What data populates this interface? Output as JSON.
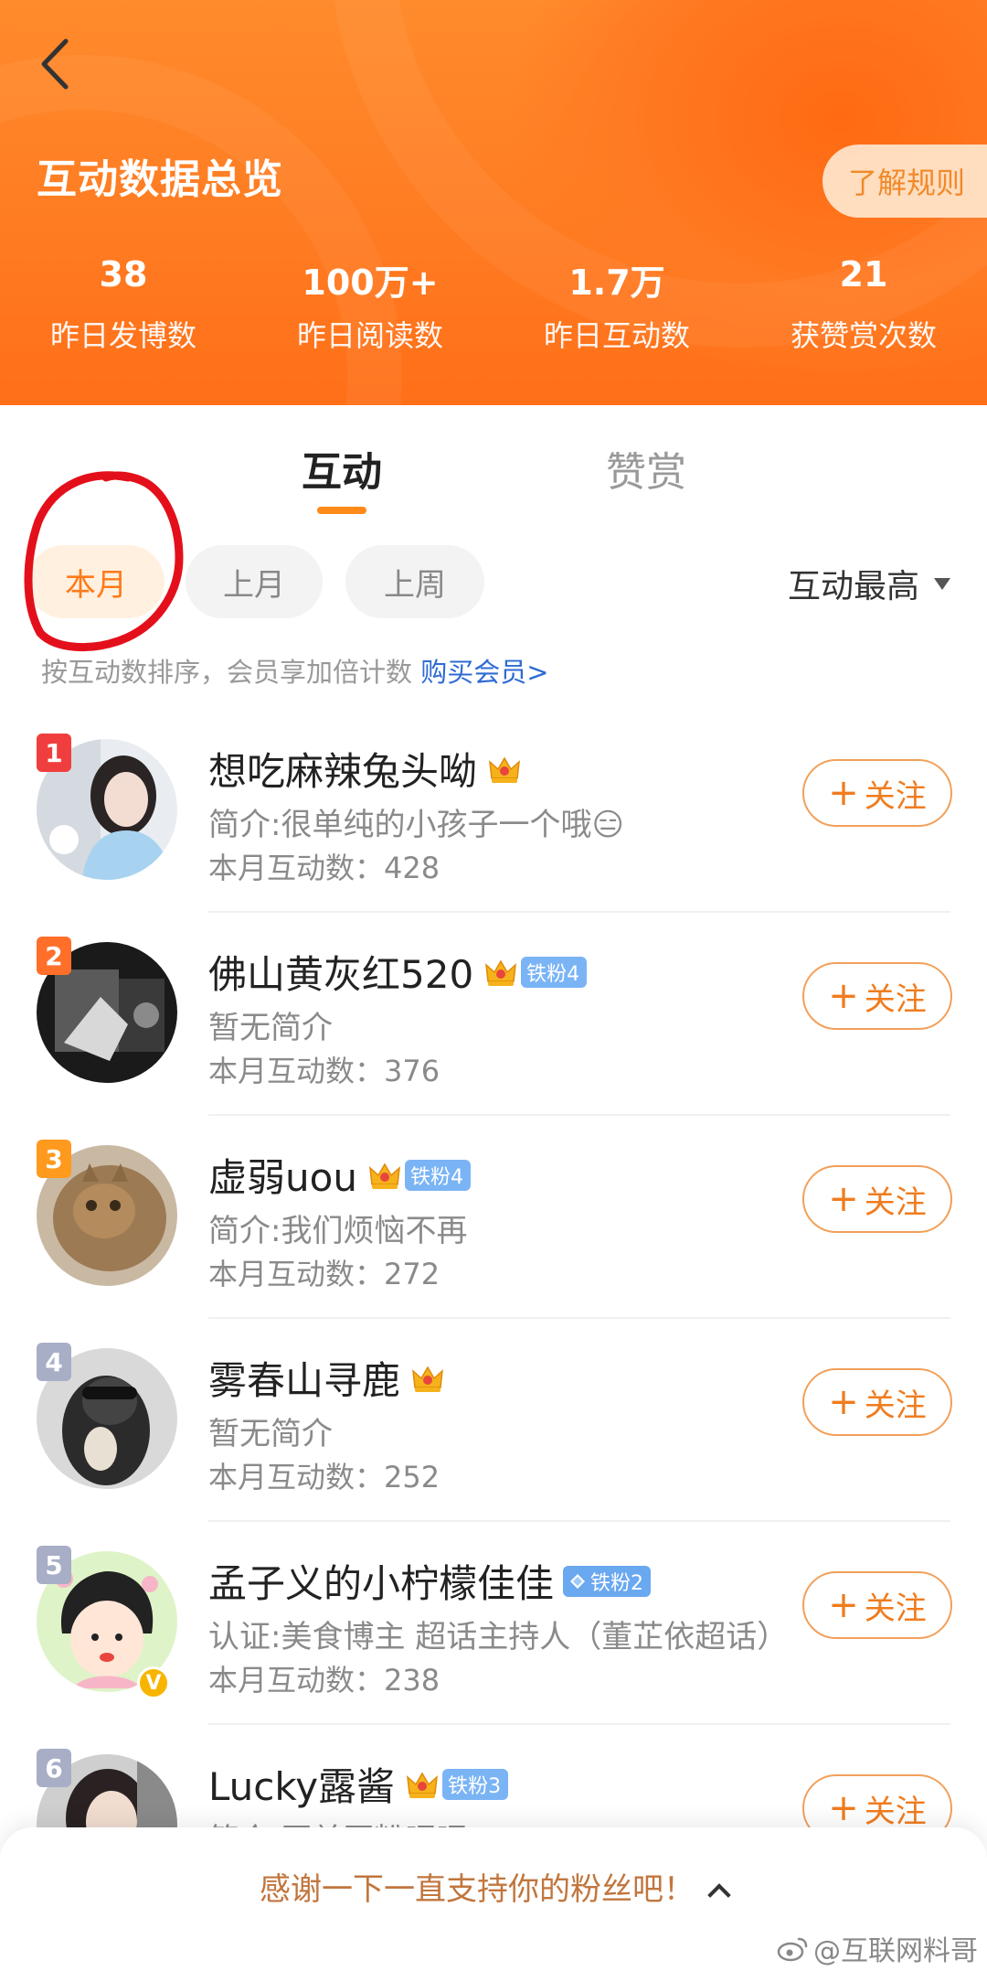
{
  "header": {
    "back_icon": "chevron-left-icon",
    "title": "互动数据总览",
    "rules_button": "了解规则",
    "stats": [
      {
        "value": "38",
        "label": "昨日发博数"
      },
      {
        "value": "100万+",
        "label": "昨日阅读数"
      },
      {
        "value": "1.7万",
        "label": "昨日互动数"
      },
      {
        "value": "21",
        "label": "获赞赏次数"
      }
    ]
  },
  "tabs": [
    {
      "label": "互动",
      "active": true
    },
    {
      "label": "赞赏",
      "active": false
    }
  ],
  "filters": {
    "periods": [
      "本月",
      "上月",
      "上周"
    ],
    "selected": "本月",
    "sort_label": "互动最高"
  },
  "hint": {
    "text": "按互动数排序，会员享加倍计数 ",
    "link": "购买会员>"
  },
  "fans": [
    {
      "rank": "1",
      "name": "想吃麻辣兔头呦",
      "fan_badge": "",
      "desc": "简介:很单纯的小孩子一个哦😑",
      "count": "本月互动数：428",
      "follow": "关注"
    },
    {
      "rank": "2",
      "name": "佛山黄灰红520",
      "fan_badge": "铁粉4",
      "desc": "暂无简介",
      "count": "本月互动数：376",
      "follow": "关注"
    },
    {
      "rank": "3",
      "name": "虚弱uou",
      "fan_badge": "铁粉4",
      "desc": "简介:我们烦恼不再",
      "count": "本月互动数：272",
      "follow": "关注"
    },
    {
      "rank": "4",
      "name": "雾春山寻鹿",
      "fan_badge": "",
      "desc": "暂无简介",
      "count": "本月互动数：252",
      "follow": "关注"
    },
    {
      "rank": "5",
      "name": "孟子义的小柠檬佳佳",
      "fan_badge": "铁粉2",
      "desc": "认证:美食博主 超话主持人（董芷依超话）",
      "count": "本月互动数：238",
      "follow": "关注"
    },
    {
      "rank": "6",
      "name": "Lucky露酱",
      "fan_badge": "铁粉3",
      "desc": "简介:互关互粉嘿嘿",
      "count": "",
      "follow": "关注"
    }
  ],
  "bottom": {
    "text": "感谢一下一直支持你的粉丝吧！",
    "watermark": "@互联网料哥"
  },
  "colors": {
    "accent": "#ff7a1a",
    "header_orange": "#ff7c22",
    "annotation_red": "#e3101c"
  }
}
